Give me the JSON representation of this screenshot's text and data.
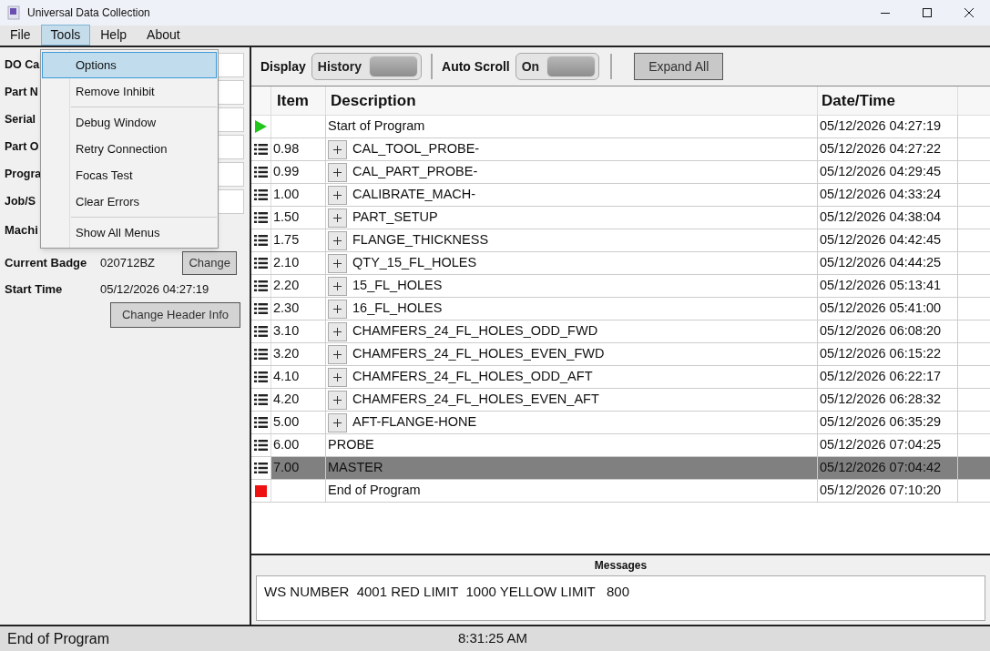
{
  "window": {
    "title": "Universal Data Collection"
  },
  "menu_bar": [
    {
      "label": "File",
      "selected": false
    },
    {
      "label": "Tools",
      "selected": true
    },
    {
      "label": "Help",
      "selected": false
    },
    {
      "label": "About",
      "selected": false
    }
  ],
  "tools_menu": [
    {
      "label": "Options",
      "selected": true,
      "separator_after": false
    },
    {
      "label": "Remove Inhibit",
      "selected": false,
      "separator_after": true
    },
    {
      "label": "Debug Window",
      "selected": false,
      "separator_after": false
    },
    {
      "label": "Retry Connection",
      "selected": false,
      "separator_after": false
    },
    {
      "label": "Focas Test",
      "selected": false,
      "separator_after": false
    },
    {
      "label": "Clear Errors",
      "selected": false,
      "separator_after": true
    },
    {
      "label": "Show All Menus",
      "selected": false,
      "separator_after": false
    }
  ],
  "header_fields": [
    {
      "label": "DO Ca"
    },
    {
      "label": "Part N"
    },
    {
      "label": "Serial"
    },
    {
      "label": "Part O"
    },
    {
      "label": "Progra"
    },
    {
      "label": "Job/S"
    }
  ],
  "machine_label": "Machi",
  "current_badge": {
    "label": "Current Badge",
    "value": "020712BZ",
    "button": "Change"
  },
  "start_time": {
    "label": "Start Time",
    "value": "05/12/2026 04:27:19"
  },
  "change_header_button": "Change Header Info",
  "toolbar": {
    "display_label": "Display",
    "display_toggle": {
      "label": "History",
      "on": true
    },
    "auto_scroll_label": "Auto Scroll",
    "auto_scroll_toggle": {
      "label": "On",
      "on": true
    },
    "expand_button": "Expand All"
  },
  "table": {
    "columns": [
      "Item",
      "Description",
      "Date/Time"
    ],
    "rows": [
      {
        "kind": "start",
        "item": "",
        "description": "Start of Program",
        "expandable": false,
        "datetime": "05/12/2026 04:27:19",
        "selected": false
      },
      {
        "kind": "step",
        "item": "0.98",
        "description": "CAL_TOOL_PROBE-",
        "expandable": true,
        "datetime": "05/12/2026 04:27:22",
        "selected": false
      },
      {
        "kind": "step",
        "item": "0.99",
        "description": "CAL_PART_PROBE-",
        "expandable": true,
        "datetime": "05/12/2026 04:29:45",
        "selected": false
      },
      {
        "kind": "step",
        "item": "1.00",
        "description": "CALIBRATE_MACH-",
        "expandable": true,
        "datetime": "05/12/2026 04:33:24",
        "selected": false
      },
      {
        "kind": "step",
        "item": "1.50",
        "description": "PART_SETUP",
        "expandable": true,
        "datetime": "05/12/2026 04:38:04",
        "selected": false
      },
      {
        "kind": "step",
        "item": "1.75",
        "description": "FLANGE_THICKNESS",
        "expandable": true,
        "datetime": "05/12/2026 04:42:45",
        "selected": false
      },
      {
        "kind": "step",
        "item": "2.10",
        "description": "QTY_15_FL_HOLES",
        "expandable": true,
        "datetime": "05/12/2026 04:44:25",
        "selected": false
      },
      {
        "kind": "step",
        "item": "2.20",
        "description": "15_FL_HOLES",
        "expandable": true,
        "datetime": "05/12/2026 05:13:41",
        "selected": false
      },
      {
        "kind": "step",
        "item": "2.30",
        "description": "16_FL_HOLES",
        "expandable": true,
        "datetime": "05/12/2026 05:41:00",
        "selected": false
      },
      {
        "kind": "step",
        "item": "3.10",
        "description": "CHAMFERS_24_FL_HOLES_ODD_FWD",
        "expandable": true,
        "datetime": "05/12/2026 06:08:20",
        "selected": false
      },
      {
        "kind": "step",
        "item": "3.20",
        "description": "CHAMFERS_24_FL_HOLES_EVEN_FWD",
        "expandable": true,
        "datetime": "05/12/2026 06:15:22",
        "selected": false
      },
      {
        "kind": "step",
        "item": "4.10",
        "description": "CHAMFERS_24_FL_HOLES_ODD_AFT",
        "expandable": true,
        "datetime": "05/12/2026 06:22:17",
        "selected": false
      },
      {
        "kind": "step",
        "item": "4.20",
        "description": "CHAMFERS_24_FL_HOLES_EVEN_AFT",
        "expandable": true,
        "datetime": "05/12/2026 06:28:32",
        "selected": false
      },
      {
        "kind": "step",
        "item": "5.00",
        "description": "AFT-FLANGE-HONE",
        "expandable": true,
        "datetime": "05/12/2026 06:35:29",
        "selected": false
      },
      {
        "kind": "step",
        "item": "6.00",
        "description": "PROBE",
        "expandable": false,
        "datetime": "05/12/2026 07:04:25",
        "selected": false
      },
      {
        "kind": "step",
        "item": "7.00",
        "description": "MASTER",
        "expandable": false,
        "datetime": "05/12/2026 07:04:42",
        "selected": true
      },
      {
        "kind": "end",
        "item": "",
        "description": "End of Program",
        "expandable": false,
        "datetime": "05/12/2026 07:10:20",
        "selected": false
      }
    ]
  },
  "messages": {
    "title": "Messages",
    "text": "WS NUMBER  4001 RED LIMIT  1000 YELLOW LIMIT   800"
  },
  "status_bar": {
    "left": "End of Program",
    "center": "8:31:25 AM"
  }
}
